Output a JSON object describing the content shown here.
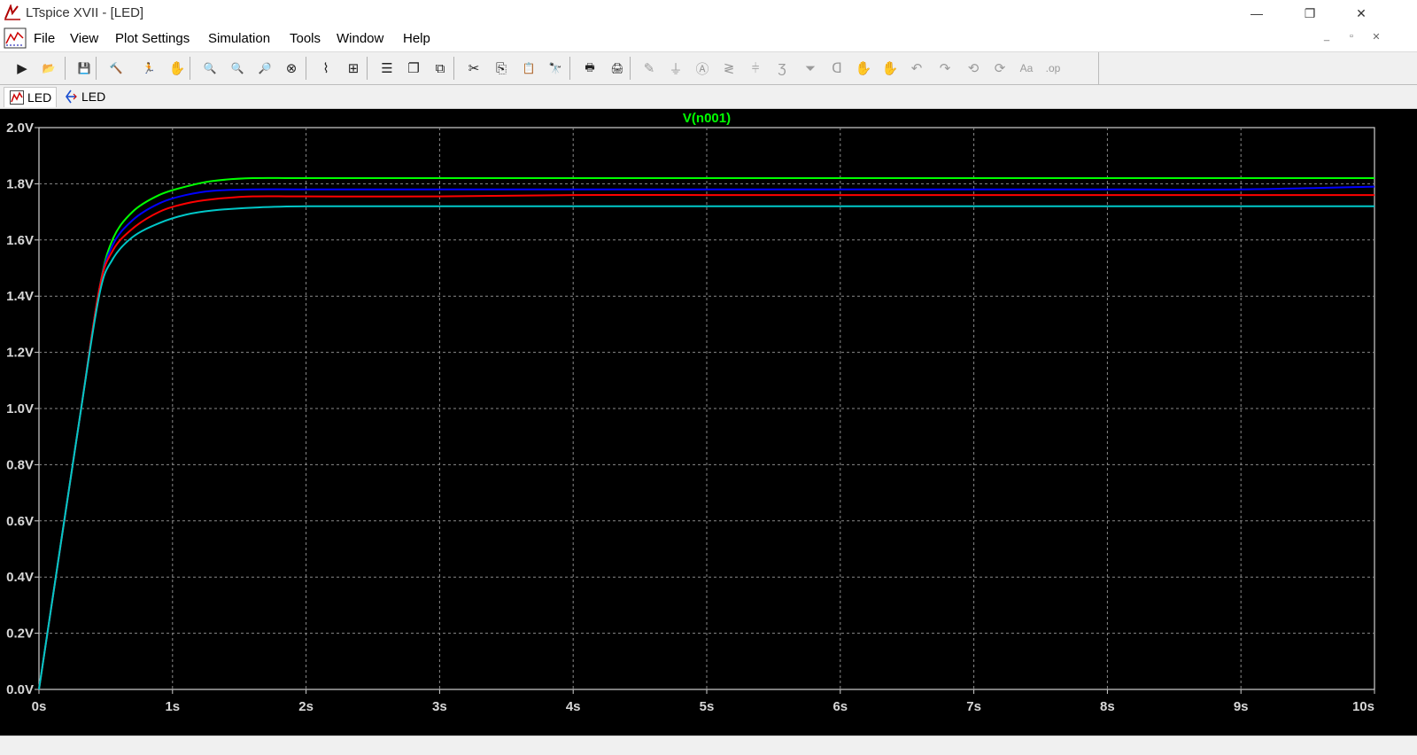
{
  "window": {
    "title": "LTspice XVII - [LED]",
    "minimize": "—",
    "restore": "❐",
    "close": "✕"
  },
  "menu": {
    "items": [
      "File",
      "View",
      "Plot Settings",
      "Simulation",
      "Tools",
      "Window",
      "Help"
    ],
    "mdi": {
      "minimize": "_",
      "restore": "▫",
      "close": "✕"
    }
  },
  "toolbar": {
    "buttons": [
      {
        "name": "run-icon",
        "glyph": "▶"
      },
      {
        "name": "open-icon",
        "glyph": "📂"
      },
      {
        "name": "save-icon",
        "glyph": "💾"
      },
      {
        "name": "control-panel-icon",
        "glyph": "🔨"
      },
      {
        "name": "halt-icon",
        "glyph": "🏃"
      },
      {
        "name": "pan-icon",
        "glyph": "✋"
      },
      {
        "name": "zoom-area-icon",
        "glyph": "🔍"
      },
      {
        "name": "zoom-in-icon",
        "glyph": "🔍"
      },
      {
        "name": "zoom-out-icon",
        "glyph": "🔎"
      },
      {
        "name": "zoom-fit-icon",
        "glyph": "⊗"
      },
      {
        "name": "autorange-icon",
        "glyph": "⌇"
      },
      {
        "name": "autorange-y-icon",
        "glyph": "⊞"
      },
      {
        "name": "tile-horizontal-icon",
        "glyph": "☰"
      },
      {
        "name": "cascade-icon",
        "glyph": "❐"
      },
      {
        "name": "tile-vertical-icon",
        "glyph": "⧉"
      },
      {
        "name": "cut-icon",
        "glyph": "✂"
      },
      {
        "name": "copy-icon",
        "glyph": "⎘"
      },
      {
        "name": "paste-icon",
        "glyph": "📋"
      },
      {
        "name": "find-icon",
        "glyph": "🔭"
      },
      {
        "name": "print-icon",
        "glyph": "🖶"
      },
      {
        "name": "print-setup-icon",
        "glyph": "🖨"
      },
      {
        "name": "wire-icon",
        "glyph": "✎"
      },
      {
        "name": "ground-icon",
        "glyph": "⏚"
      },
      {
        "name": "label-icon",
        "glyph": "Ⓐ"
      },
      {
        "name": "resistor-icon",
        "glyph": "≷"
      },
      {
        "name": "capacitor-icon",
        "glyph": "⫩"
      },
      {
        "name": "inductor-icon",
        "glyph": "Ʒ"
      },
      {
        "name": "diode-icon",
        "glyph": "⏷"
      },
      {
        "name": "component-icon",
        "glyph": "ᗡ"
      },
      {
        "name": "move-icon",
        "glyph": "✋"
      },
      {
        "name": "drag-icon",
        "glyph": "✋"
      },
      {
        "name": "undo-icon",
        "glyph": "↶"
      },
      {
        "name": "redo-icon",
        "glyph": "↷"
      },
      {
        "name": "rotate-icon",
        "glyph": "⟲"
      },
      {
        "name": "mirror-icon",
        "glyph": "⟳"
      },
      {
        "name": "text-icon",
        "glyph": "Aa"
      },
      {
        "name": "spice-directive-icon",
        "glyph": ".op"
      }
    ]
  },
  "tabs": [
    {
      "label": "LED",
      "kind": "waveform"
    },
    {
      "label": "LED",
      "kind": "schematic"
    }
  ],
  "chart_data": {
    "type": "line",
    "title": "V(n001)",
    "title_color": "#00ff00",
    "xlabel": "",
    "ylabel": "",
    "x_ticks": [
      "0s",
      "1s",
      "2s",
      "3s",
      "4s",
      "5s",
      "6s",
      "7s",
      "8s",
      "9s",
      "10s"
    ],
    "y_ticks": [
      "0.0V",
      "0.2V",
      "0.4V",
      "0.6V",
      "0.8V",
      "1.0V",
      "1.2V",
      "1.4V",
      "1.6V",
      "1.8V",
      "2.0V"
    ],
    "xlim": [
      0,
      10
    ],
    "ylim": [
      0,
      2.0
    ],
    "grid": true,
    "background": "#000000",
    "series": [
      {
        "color": "#00ff00",
        "x": [
          0,
          0.3,
          0.45,
          0.55,
          0.7,
          0.9,
          1.1,
          1.3,
          1.6,
          2,
          3,
          4,
          5,
          6,
          7,
          8,
          9,
          10
        ],
        "y": [
          0,
          0.95,
          1.42,
          1.6,
          1.7,
          1.76,
          1.79,
          1.81,
          1.82,
          1.82,
          1.82,
          1.82,
          1.82,
          1.82,
          1.82,
          1.82,
          1.82,
          1.82
        ]
      },
      {
        "color": "#0000ff",
        "x": [
          0,
          0.3,
          0.45,
          0.55,
          0.7,
          0.9,
          1.1,
          1.3,
          1.6,
          2,
          3,
          4,
          5,
          6,
          7,
          8,
          9,
          10
        ],
        "y": [
          0,
          0.95,
          1.42,
          1.58,
          1.67,
          1.73,
          1.76,
          1.775,
          1.78,
          1.78,
          1.78,
          1.78,
          1.78,
          1.78,
          1.78,
          1.78,
          1.78,
          1.79
        ]
      },
      {
        "color": "#ff0000",
        "x": [
          0,
          0.3,
          0.45,
          0.55,
          0.7,
          0.9,
          1.1,
          1.3,
          1.6,
          2,
          3,
          4,
          5,
          6,
          7,
          8,
          9,
          10
        ],
        "y": [
          0,
          0.95,
          1.42,
          1.56,
          1.64,
          1.7,
          1.73,
          1.745,
          1.755,
          1.755,
          1.755,
          1.76,
          1.76,
          1.76,
          1.76,
          1.76,
          1.76,
          1.76
        ]
      },
      {
        "color": "#00c8c8",
        "x": [
          0,
          0.3,
          0.45,
          0.55,
          0.7,
          0.9,
          1.1,
          1.3,
          1.6,
          2,
          3,
          4,
          5,
          6,
          7,
          8,
          9,
          10
        ],
        "y": [
          0,
          0.95,
          1.4,
          1.53,
          1.61,
          1.66,
          1.69,
          1.705,
          1.715,
          1.72,
          1.72,
          1.72,
          1.72,
          1.72,
          1.72,
          1.72,
          1.72,
          1.72
        ]
      }
    ]
  }
}
